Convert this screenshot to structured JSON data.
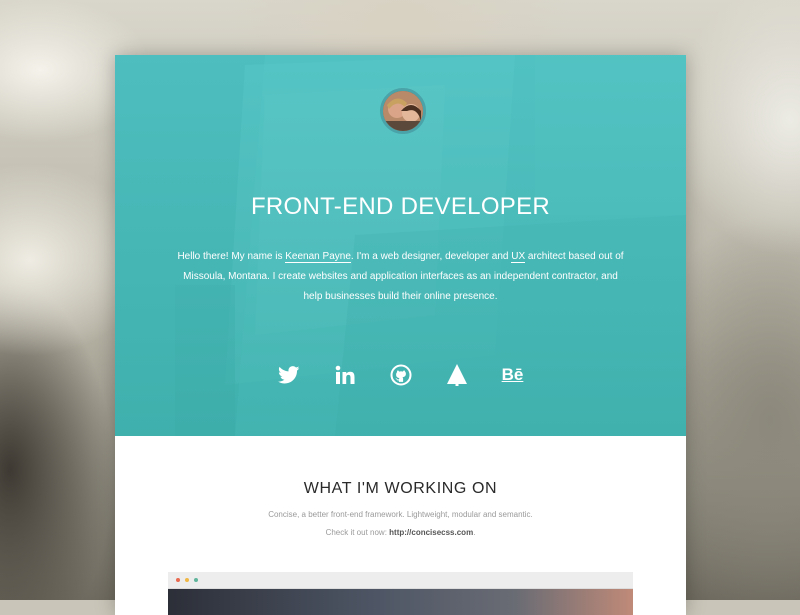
{
  "hero": {
    "title": "FRONT-END DEVELOPER",
    "intro": {
      "before_name": "Hello there! My name is ",
      "name_link": "Keenan Payne",
      "after_name": ". I'm a web designer, developer and ",
      "ux_link": "UX",
      "after_ux": " architect based out of Missoula, Montana. I create websites and application interfaces as an independent contractor, and help businesses build their online presence."
    },
    "socials": [
      {
        "icon": "twitter-icon"
      },
      {
        "icon": "linkedin-icon"
      },
      {
        "icon": "github-icon"
      },
      {
        "icon": "forrst-icon"
      },
      {
        "icon": "behance-icon",
        "text": "Bē"
      }
    ],
    "accent_color": "#52bfbf"
  },
  "working_on": {
    "title": "WHAT I'M WORKING ON",
    "description": "Concise, a better front-end framework. Lightweight, modular and semantic.",
    "check_prefix": "Check it out now: ",
    "link": "http://concisecss.com",
    "link_suffix": ".",
    "window_dots": [
      "#e8694f",
      "#f0b745",
      "#5fb59b"
    ]
  }
}
